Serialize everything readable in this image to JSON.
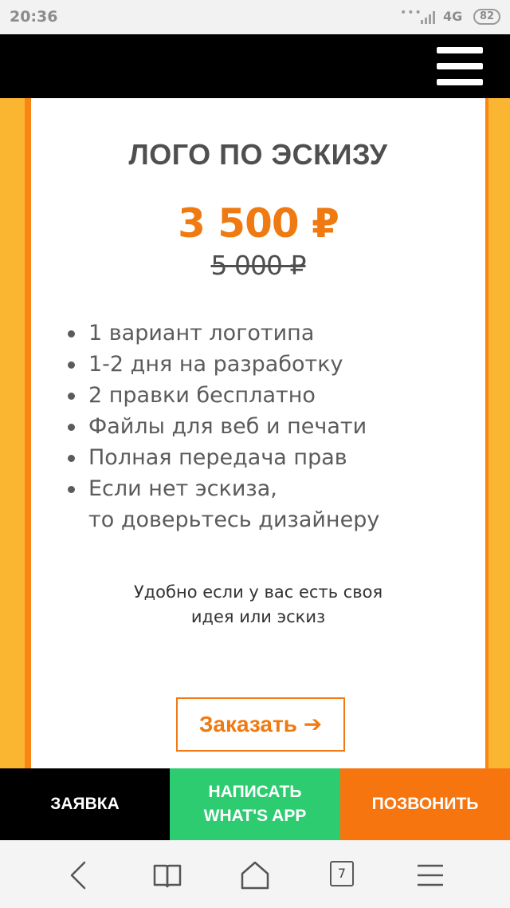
{
  "status_bar": {
    "time": "20:36",
    "dots": "•••",
    "network": "4G",
    "battery": "82"
  },
  "card": {
    "title": "ЛОГО ПО ЭСКИЗУ",
    "price": "3 500 ₽",
    "old_price": "5 000 ₽",
    "features": [
      "1 вариант логотипа",
      "1-2 дня на разработку",
      "2 правки бесплатно",
      "Файлы для веб и печати",
      "Полная передача прав",
      "Если нет эскиза,\nто доверьтесь дизайнеру"
    ],
    "note": "Удобно если у вас есть своя\nидея или эскиз",
    "order_button": "Заказать ➔"
  },
  "action_bar": {
    "request": "ЗАЯВКА",
    "whatsapp": "НАПИСАТЬ\nWHAT'S APP",
    "call": "ПОЗВОНИТЬ"
  },
  "browser_nav": {
    "tabs_count": "7"
  },
  "colors": {
    "accent_orange": "#f07a12",
    "side_yellow": "#fbb631",
    "whatsapp_green": "#2ecc71",
    "call_orange": "#f7750f"
  }
}
